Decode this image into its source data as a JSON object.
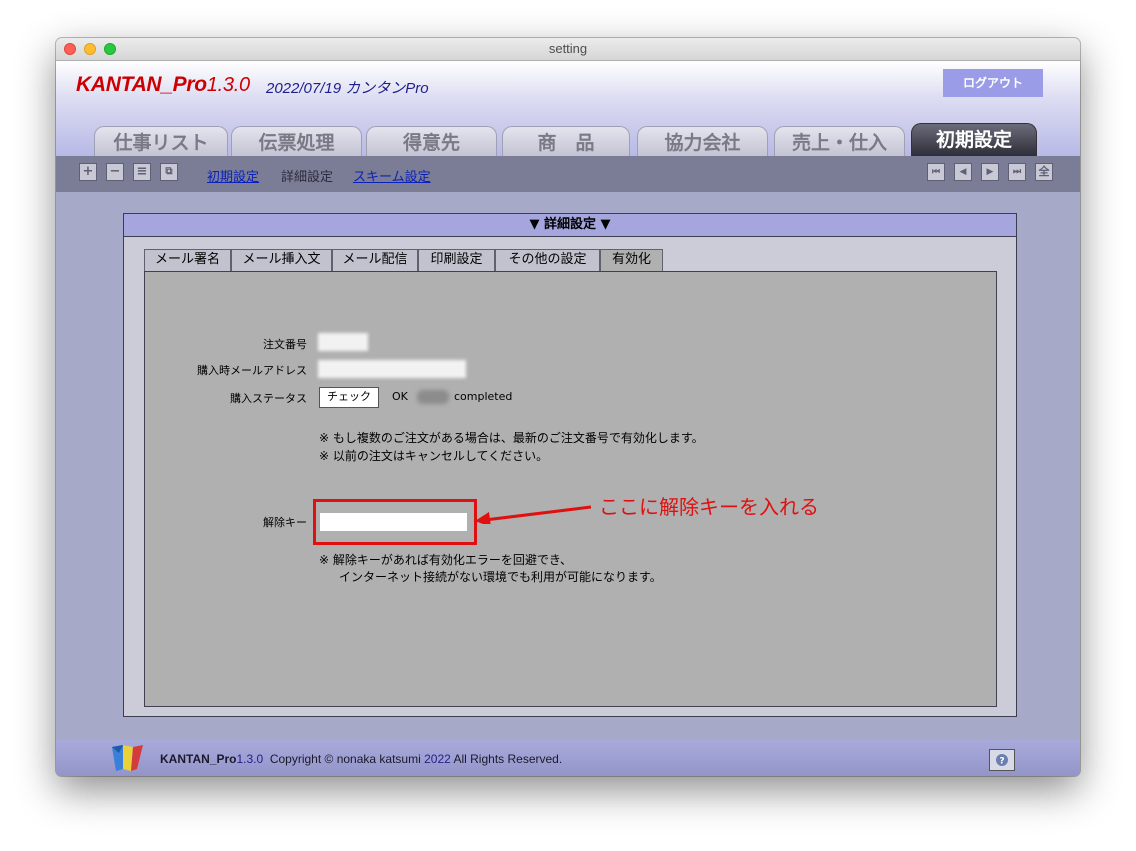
{
  "window": {
    "title": "setting"
  },
  "header": {
    "app_name": "KANTAN_Pro",
    "app_version": "1.3.0",
    "subtitle": "2022/07/19 カンタンPro",
    "logout_label": "ログアウト"
  },
  "main_tabs": [
    {
      "label": "仕事リスト"
    },
    {
      "label": "伝票処理"
    },
    {
      "label": "得意先"
    },
    {
      "label": "商　品"
    },
    {
      "label": "協力会社"
    },
    {
      "label": "売上・仕入"
    },
    {
      "label": "初期設定",
      "active": true
    }
  ],
  "toolbar": {
    "left_buttons": [
      "plus-icon",
      "minus-icon",
      "list-icon",
      "copy-icon"
    ],
    "links": [
      {
        "label": "初期設定",
        "link": true
      },
      {
        "label": "詳細設定",
        "link": false
      },
      {
        "label": "スキーム設定",
        "link": true
      }
    ],
    "nav_buttons": [
      "first-icon",
      "prev-icon",
      "next-icon",
      "last-icon"
    ],
    "all_label": "全"
  },
  "panel": {
    "header": "▼ 詳細設定 ▼",
    "subtabs": [
      {
        "label": "メール署名"
      },
      {
        "label": "メール挿入文"
      },
      {
        "label": "メール配信"
      },
      {
        "label": "印刷設定"
      },
      {
        "label": "その他の設定"
      },
      {
        "label": "有効化",
        "active": true
      }
    ],
    "form": {
      "order_number_label": "注文番号",
      "purchase_email_label": "購入時メールアドレス",
      "status_label": "購入ステータス",
      "check_button": "チェック",
      "status_ok": "OK",
      "status_completed": "completed",
      "note1_line1": "※ もし複数のご注文がある場合は、最新のご注文番号で有効化します。",
      "note1_line2": "※ 以前の注文はキャンセルしてください。",
      "unlock_key_label": "解除キー",
      "note2_line1": "※ 解除キーがあれば有効化エラーを回避でき、",
      "note2_line2": "インターネット接続がない環境でも利用が可能になります。"
    },
    "annotation": "ここに解除キーを入れる"
  },
  "footer": {
    "app_name": "KANTAN_Pro",
    "app_version": "1.3.0",
    "copyright_prefix": "Copyright © nonaka katsumi",
    "year": "2022",
    "rights": "All Rights Reserved."
  },
  "colors": {
    "accent_red": "#cc0000",
    "annotation_red": "#e01010",
    "header_bar": "#a5a6de"
  }
}
